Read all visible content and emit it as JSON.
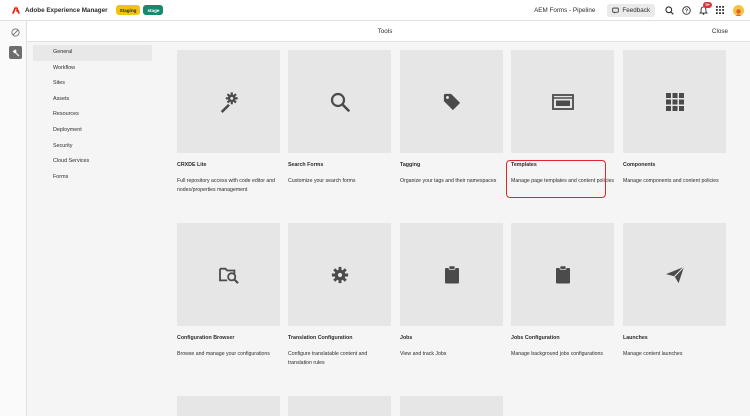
{
  "topbar": {
    "app_title": "Adobe Experience Manager",
    "badge_staging": "Staging",
    "badge_stage": "stage",
    "program_name": "AEM Forms - Pipeline",
    "feedback_label": "Feedback",
    "notification_count": "9+",
    "icons": [
      "search-icon",
      "help-icon",
      "bell-icon",
      "apps-grid-icon"
    ]
  },
  "header": {
    "title": "Tools",
    "close_label": "Close"
  },
  "sidebar": {
    "categories": [
      {
        "label": "General"
      },
      {
        "label": "Workflow"
      },
      {
        "label": "Sites"
      },
      {
        "label": "Assets"
      },
      {
        "label": "Resources"
      },
      {
        "label": "Deployment"
      },
      {
        "label": "Security"
      },
      {
        "label": "Cloud Services"
      },
      {
        "label": "Forms"
      }
    ]
  },
  "tiles": [
    {
      "title": "CRXDE Lite",
      "desc": "Full repository access with code editor and nodes/properties management",
      "icon": "gears-icon"
    },
    {
      "title": "Search Forms",
      "desc": "Customize your search forms",
      "icon": "search-icon"
    },
    {
      "title": "Tagging",
      "desc": "Organize your tags and their namespaces",
      "icon": "tag-icon"
    },
    {
      "title": "Templates",
      "desc": "Manage page templates and content policies",
      "icon": "template-icon"
    },
    {
      "title": "Components",
      "desc": "Manage components and content policies",
      "icon": "grid-icon"
    },
    {
      "title": "Configuration Browser",
      "desc": "Browse and manage your configurations",
      "icon": "folder-search-icon"
    },
    {
      "title": "Translation Configuration",
      "desc": "Configure translatable content and translation rules",
      "icon": "gear-icon"
    },
    {
      "title": "Jobs",
      "desc": "View and track Jobs",
      "icon": "clipboard-icon"
    },
    {
      "title": "Jobs Configuration",
      "desc": "Manage background jobs configurations",
      "icon": "clipboard-icon"
    },
    {
      "title": "Launches",
      "desc": "Manage content launches",
      "icon": "send-icon"
    }
  ]
}
